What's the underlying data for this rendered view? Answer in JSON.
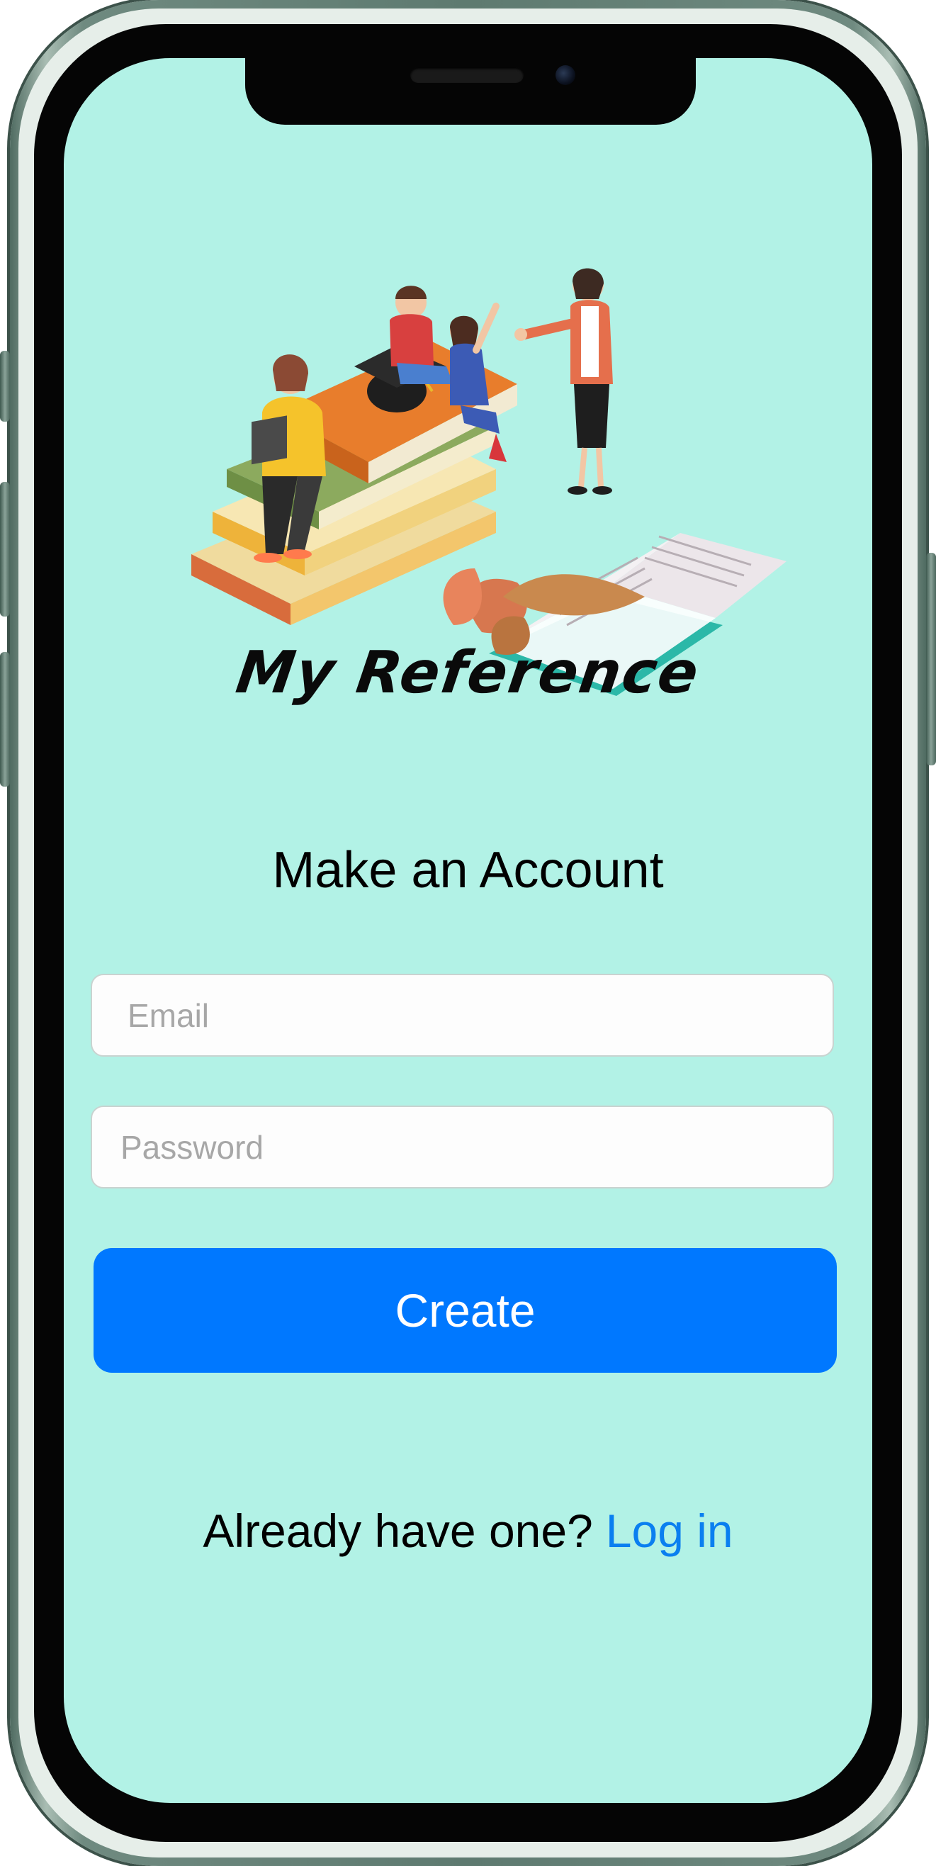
{
  "app": {
    "logo_text": "My Reference"
  },
  "signup": {
    "title": "Make an Account",
    "email_placeholder": "Email",
    "password_placeholder": "Password",
    "create_label": "Create",
    "prompt_text": "Already have one?",
    "login_label": "Log in"
  },
  "colors": {
    "screen_background": "#b2f2e6",
    "primary_button": "#0078ff",
    "link": "#0a7ff0"
  },
  "icons": {
    "illustration": "students-books-teacher-illustration"
  }
}
